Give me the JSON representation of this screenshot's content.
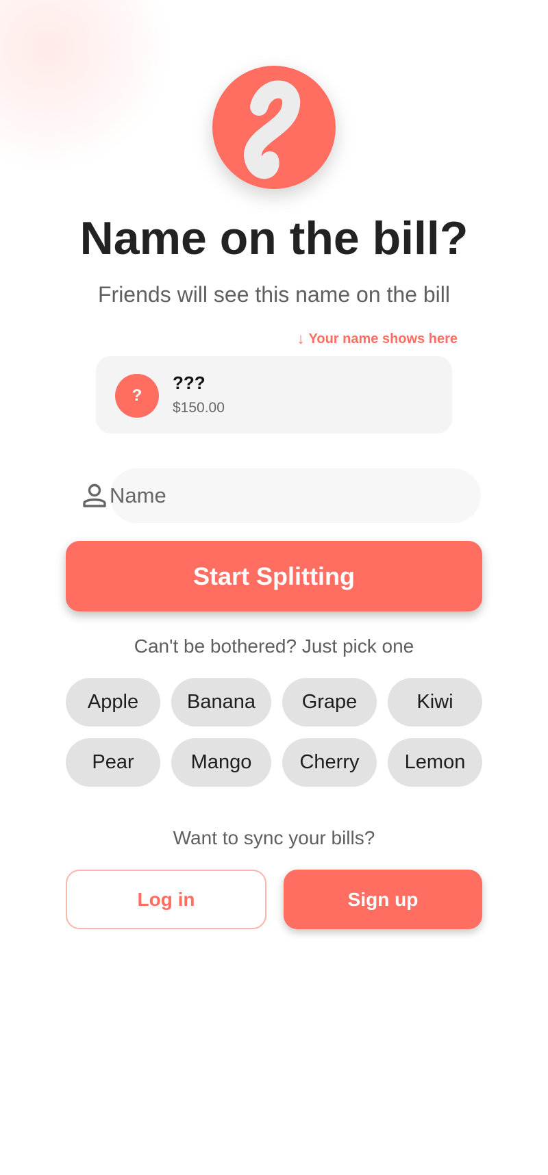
{
  "header": {
    "logo_icon": "squiggle-logo-icon",
    "title": "Name on the bill?",
    "subtitle": "Friends will see this name on the bill"
  },
  "preview": {
    "hint": "Your name shows here",
    "hint_icon": "arrow-down-icon",
    "avatar_text": "?",
    "name": "???",
    "amount": "$150.00"
  },
  "name_field": {
    "icon": "person-icon",
    "placeholder": "Name",
    "value": ""
  },
  "start_button": {
    "label": "Start Splitting"
  },
  "quick_pick": {
    "label": "Can't be bothered? Just pick one",
    "options": [
      "Apple",
      "Banana",
      "Grape",
      "Kiwi",
      "Pear",
      "Mango",
      "Cherry",
      "Lemon"
    ]
  },
  "sync": {
    "label": "Want to sync your bills?",
    "login_label": "Log in",
    "signup_label": "Sign up"
  },
  "colors": {
    "accent": "#FF6E61",
    "chip_background": "#E2E2E2",
    "card_background": "#F4F4F4",
    "title_text": "#222222"
  }
}
